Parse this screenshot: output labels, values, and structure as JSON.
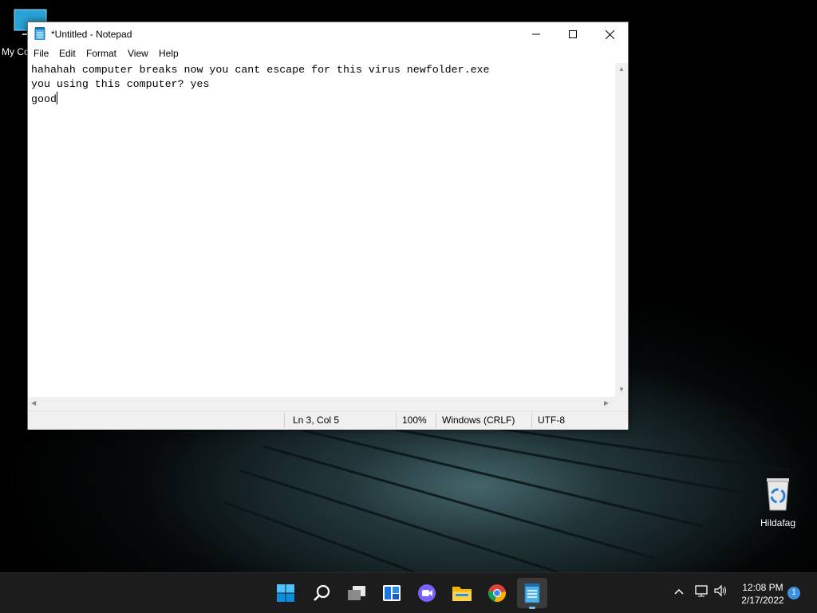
{
  "desktop": {
    "icons": [
      {
        "label": "My Co"
      },
      {
        "label": "Hildafag"
      }
    ]
  },
  "notepad": {
    "title": "*Untitled - Notepad",
    "menu": [
      "File",
      "Edit",
      "Format",
      "View",
      "Help"
    ],
    "lines": [
      "hahahah computer breaks now you cant escape for this virus newfolder.exe",
      "you using this computer? yes",
      "good"
    ],
    "status": {
      "position": "Ln 3, Col 5",
      "zoom": "100%",
      "line_ending": "Windows (CRLF)",
      "encoding": "UTF-8"
    }
  },
  "taskbar": {
    "apps": [
      "start-icon",
      "search-icon",
      "task-view-icon",
      "widgets-icon",
      "teams-chat-icon",
      "file-explorer-icon",
      "chrome-icon",
      "notepad-icon"
    ],
    "clock": {
      "time": "12:08 PM",
      "date": "2/17/2022"
    },
    "notification_count": "1"
  },
  "colors": {
    "accent": "#76b9ed",
    "taskbar": "#1c1c1c",
    "notification_badge": "#3d8fe0"
  }
}
